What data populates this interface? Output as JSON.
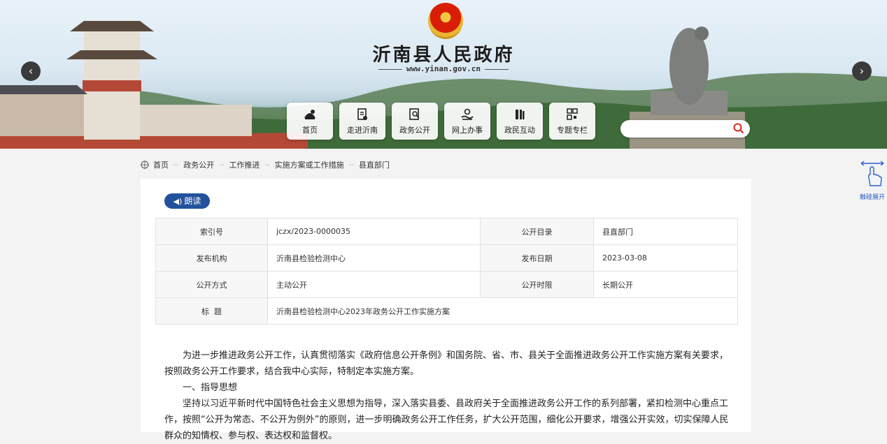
{
  "header": {
    "site_title": "沂南县人民政府",
    "site_url": "www.yinan.gov.cn",
    "nav": [
      {
        "label": "首页",
        "icon": "home-icon"
      },
      {
        "label": "走进沂南",
        "icon": "document-icon"
      },
      {
        "label": "政务公开",
        "icon": "search-document-icon"
      },
      {
        "label": "网上办事",
        "icon": "service-hand-icon"
      },
      {
        "label": "政民互动",
        "icon": "books-icon"
      },
      {
        "label": "专题专栏",
        "icon": "grid-icon"
      }
    ],
    "search_placeholder": ""
  },
  "breadcrumb": [
    "首页",
    "政务公开",
    "工作推进",
    "实施方案或工作措施",
    "县直部门"
  ],
  "side_widget": {
    "label": "触碰展开",
    "icon": "hand-pointer-icon"
  },
  "read_button": {
    "label": "朗读",
    "icon": "speaker-icon"
  },
  "meta_table": {
    "rows": [
      {
        "k1": "索引号",
        "v1": "jczx/2023-0000035",
        "k2": "公开目录",
        "v2": "县直部门"
      },
      {
        "k1": "发布机构",
        "v1": "沂南县检验检测中心",
        "k2": "发布日期",
        "v2": "2023-03-08"
      },
      {
        "k1": "公开方式",
        "v1": "主动公开",
        "k2": "公开时限",
        "v2": "长期公开"
      }
    ],
    "title_key": "标  题",
    "title_value": "沂南县检验检测中心2023年政务公开工作实施方案"
  },
  "content": {
    "p1": "为进一步推进政务公开工作，认真贯彻落实《政府信息公开条例》和国务院、省、市、县关于全面推进政务公开工作实施方案有关要求，按照政务公开工作要求，结合我中心实际，特制定本实施方案。",
    "p2": "一、指导思想",
    "p3": "坚持以习近平新时代中国特色社会主义思想为指导，深入落实县委、县政府关于全面推进政务公开工作的系列部署，紧扣检测中心重点工作，按照“公开为常态、不公开为例外”的原则，进一步明确政务公开工作任务，扩大公开范围，细化公开要求，增强公开实效，切实保障人民群众的知情权、参与权、表达权和监督权。"
  },
  "colors": {
    "primary_blue": "#22529d",
    "link_blue": "#2a62c9",
    "search_red": "#d8261c"
  }
}
